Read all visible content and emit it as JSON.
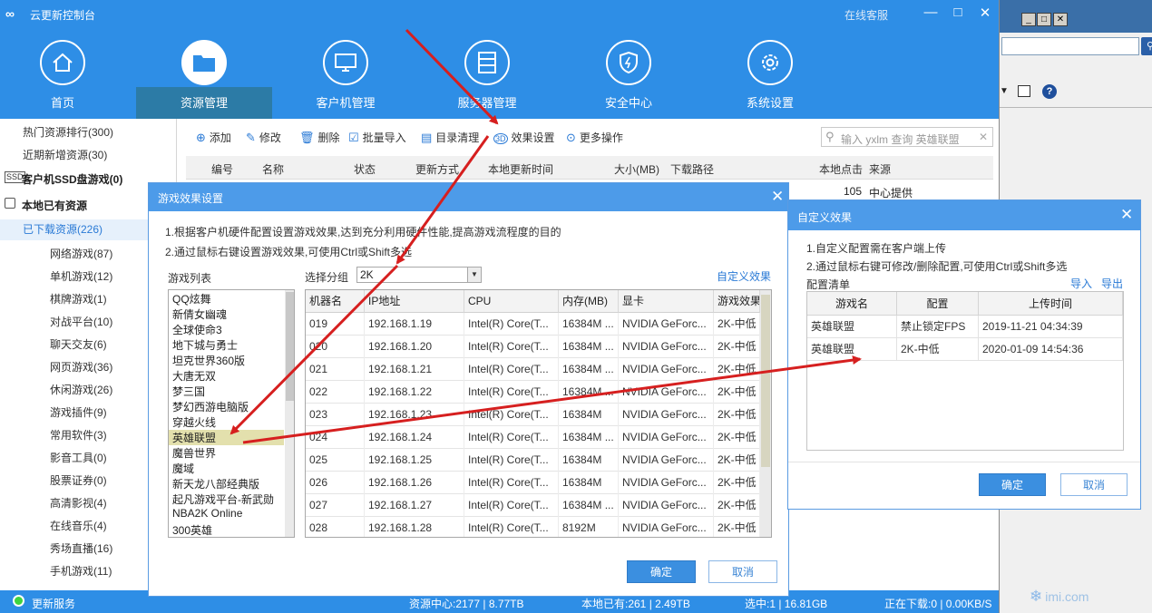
{
  "app": {
    "logo": "∞",
    "title": "云更新控制台",
    "online_service": "在线客服",
    "window_controls": [
      "—",
      "□",
      "✕"
    ]
  },
  "nav": [
    {
      "label": "首页",
      "icon": "home-icon"
    },
    {
      "label": "资源管理",
      "icon": "folder-icon",
      "active": true
    },
    {
      "label": "客户机管理",
      "icon": "monitor-icon"
    },
    {
      "label": "服务器管理",
      "icon": "server-icon"
    },
    {
      "label": "安全中心",
      "icon": "shield-icon"
    },
    {
      "label": "系统设置",
      "icon": "gear-icon"
    }
  ],
  "sidebar": {
    "items": [
      {
        "label": "热门资源排行(300)"
      },
      {
        "label": "近期新增资源(30)"
      },
      {
        "label": "客户机SSD盘游戏(0)",
        "bold": true,
        "icon": "ssd-icon"
      },
      {
        "label": "本地已有资源",
        "bold": true,
        "icon": "hdd-icon"
      },
      {
        "label": "已下载资源(226)",
        "selected": true
      },
      {
        "label": "网络游戏(87)"
      },
      {
        "label": "单机游戏(12)"
      },
      {
        "label": "棋牌游戏(1)"
      },
      {
        "label": "对战平台(10)"
      },
      {
        "label": "聊天交友(6)"
      },
      {
        "label": "网页游戏(36)"
      },
      {
        "label": "休闲游戏(26)"
      },
      {
        "label": "游戏插件(9)"
      },
      {
        "label": "常用软件(3)"
      },
      {
        "label": "影音工具(0)"
      },
      {
        "label": "股票证券(0)"
      },
      {
        "label": "高清影视(4)"
      },
      {
        "label": "在线音乐(4)"
      },
      {
        "label": "秀场直播(16)"
      },
      {
        "label": "手机游戏(11)"
      }
    ]
  },
  "toolbar": {
    "items": [
      {
        "label": "添加",
        "icon": "plus-icon"
      },
      {
        "label": "修改",
        "icon": "pencil-icon"
      },
      {
        "label": "删除",
        "icon": "trash-icon"
      },
      {
        "label": "批量导入",
        "icon": "import-icon"
      },
      {
        "label": "目录清理",
        "icon": "clean-icon"
      },
      {
        "label": "效果设置",
        "icon": "3d-icon"
      },
      {
        "label": "更多操作",
        "icon": "more-icon"
      }
    ],
    "search_placeholder": "输入 yxlm 查询 英雄联盟",
    "search_clear": "✕"
  },
  "main_table": {
    "headers": [
      "编号",
      "名称",
      "状态",
      "更新方式",
      "本地更新时间",
      "大小(MB)",
      "下载路径",
      "本地点击",
      "来源"
    ],
    "visible_row": {
      "clicks": "105",
      "source": "中心提供"
    }
  },
  "status_bar": {
    "update_service": "更新服务",
    "resource_center": "资源中心:2177 | 8.77TB",
    "local": "本地已有:261 | 2.49TB",
    "selected": "选中:1 | 16.81GB",
    "downloading": "正在下载:0 | 0.00KB/S"
  },
  "dialog1": {
    "title": "游戏效果设置",
    "close": "✕",
    "tip1": "1.根据客户机硬件配置设置游戏效果,达到充分利用硬件性能,提高游戏流程度的目的",
    "tip2": "2.通过鼠标右键设置游戏效果,可使用Ctrl或Shift多选",
    "game_list_label": "游戏列表",
    "group_label": "选择分组",
    "group_value": "2K",
    "custom_link": "自定义效果",
    "games": [
      "QQ炫舞",
      "新倩女幽魂",
      "全球使命3",
      "地下城与勇士",
      "坦克世界360版",
      "大唐无双",
      "梦三国",
      "梦幻西游电脑版",
      "穿越火线",
      "英雄联盟",
      "魔兽世界",
      "魔域",
      "新天龙八部经典版",
      "起凡游戏平台-新武勋",
      "NBA2K Online",
      "300英雄"
    ],
    "selected_game": "英雄联盟",
    "table_headers": [
      "机器名",
      "IP地址",
      "CPU",
      "内存(MB)",
      "显卡",
      "游戏效果"
    ],
    "rows": [
      [
        "019",
        "192.168.1.19",
        "Intel(R) Core(T...",
        "16384M ...",
        "NVIDIA GeForc...",
        "2K-中低"
      ],
      [
        "020",
        "192.168.1.20",
        "Intel(R) Core(T...",
        "16384M ...",
        "NVIDIA GeForc...",
        "2K-中低"
      ],
      [
        "021",
        "192.168.1.21",
        "Intel(R) Core(T...",
        "16384M ...",
        "NVIDIA GeForc...",
        "2K-中低"
      ],
      [
        "022",
        "192.168.1.22",
        "Intel(R) Core(T...",
        "16384M ...",
        "NVIDIA GeForc...",
        "2K-中低"
      ],
      [
        "023",
        "192.168.1.23",
        "Intel(R) Core(T...",
        "16384M",
        "NVIDIA GeForc...",
        "2K-中低"
      ],
      [
        "024",
        "192.168.1.24",
        "Intel(R) Core(T...",
        "16384M ...",
        "NVIDIA GeForc...",
        "2K-中低"
      ],
      [
        "025",
        "192.168.1.25",
        "Intel(R) Core(T...",
        "16384M",
        "NVIDIA GeForc...",
        "2K-中低"
      ],
      [
        "026",
        "192.168.1.26",
        "Intel(R) Core(T...",
        "16384M",
        "NVIDIA GeForc...",
        "2K-中低"
      ],
      [
        "027",
        "192.168.1.27",
        "Intel(R) Core(T...",
        "16384M ...",
        "NVIDIA GeForc...",
        "2K-中低"
      ],
      [
        "028",
        "192.168.1.28",
        "Intel(R) Core(T...",
        "8192M",
        "NVIDIA GeForc...",
        "2K-中低"
      ]
    ],
    "ok": "确定",
    "cancel": "取消"
  },
  "dialog2": {
    "title": "自定义效果",
    "close": "✕",
    "tip1": "1.自定义配置需在客户端上传",
    "tip2": "2.通过鼠标右键可修改/删除配置,可使用Ctrl或Shift多选",
    "list_label": "配置清单",
    "import": "导入",
    "export": "导出",
    "table_headers": [
      "游戏名",
      "配置",
      "上传时间"
    ],
    "rows": [
      [
        "英雄联盟",
        "禁止锁定FPS",
        "2019-11-21 04:34:39"
      ],
      [
        "英雄联盟",
        "2K-中低",
        "2020-01-09 14:54:36"
      ]
    ],
    "ok": "确定",
    "cancel": "取消"
  },
  "right_window": {
    "buttons": [
      "_",
      "□",
      "✕"
    ]
  },
  "watermark": "imi.com",
  "annotation_color": "#d61f1f"
}
